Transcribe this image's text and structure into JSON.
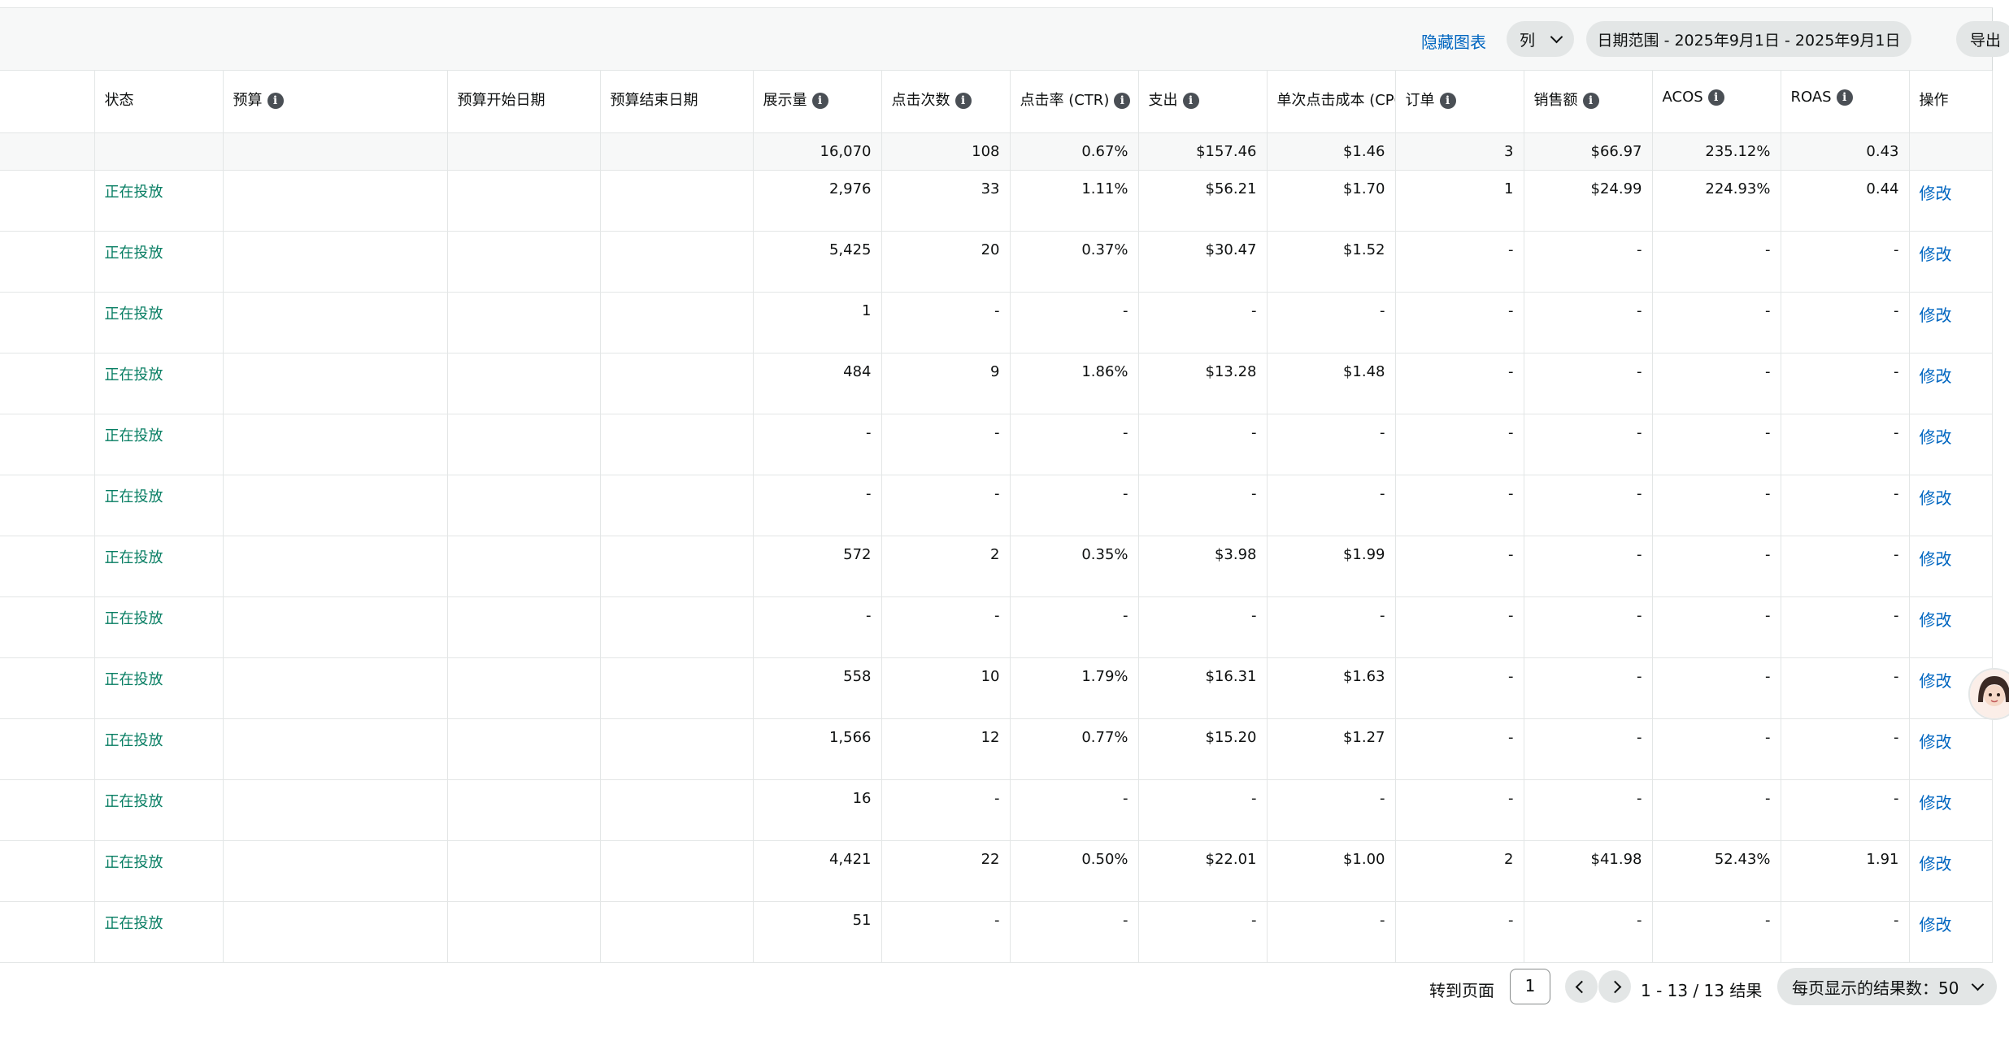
{
  "toolbar": {
    "hide_chart": "隐藏图表",
    "columns": "列",
    "date_range": "日期范围 - 2025年9月1日 - 2025年9月1日",
    "export": "导出"
  },
  "columns": [
    "状态",
    "预算",
    "预算开始日期",
    "预算结束日期",
    "展示量",
    "点击次数",
    "点击率 (CTR)",
    "支出",
    "单次点击成本 (CPC)",
    "订单",
    "销售额",
    "ACOS",
    "ROAS",
    "操作"
  ],
  "summary": [
    "",
    "",
    "",
    "",
    "16,070",
    "108",
    "0.67%",
    "$157.46",
    "$1.46",
    "3",
    "$66.97",
    "235.12%",
    "0.43",
    ""
  ],
  "rows": [
    [
      "正在投放",
      "",
      "",
      "",
      "2,976",
      "33",
      "1.11%",
      "$56.21",
      "$1.70",
      "1",
      "$24.99",
      "224.93%",
      "0.44",
      "修改"
    ],
    [
      "正在投放",
      "",
      "",
      "",
      "5,425",
      "20",
      "0.37%",
      "$30.47",
      "$1.52",
      "-",
      "-",
      "-",
      "-",
      "修改"
    ],
    [
      "正在投放",
      "",
      "",
      "",
      "1",
      "-",
      "-",
      "-",
      "-",
      "-",
      "-",
      "-",
      "-",
      "修改"
    ],
    [
      "正在投放",
      "",
      "",
      "",
      "484",
      "9",
      "1.86%",
      "$13.28",
      "$1.48",
      "-",
      "-",
      "-",
      "-",
      "修改"
    ],
    [
      "正在投放",
      "",
      "",
      "",
      "-",
      "-",
      "-",
      "-",
      "-",
      "-",
      "-",
      "-",
      "-",
      "修改"
    ],
    [
      "正在投放",
      "",
      "",
      "",
      "-",
      "-",
      "-",
      "-",
      "-",
      "-",
      "-",
      "-",
      "-",
      "修改"
    ],
    [
      "正在投放",
      "",
      "",
      "",
      "572",
      "2",
      "0.35%",
      "$3.98",
      "$1.99",
      "-",
      "-",
      "-",
      "-",
      "修改"
    ],
    [
      "正在投放",
      "",
      "",
      "",
      "-",
      "-",
      "-",
      "-",
      "-",
      "-",
      "-",
      "-",
      "-",
      "修改"
    ],
    [
      "正在投放",
      "",
      "",
      "",
      "558",
      "10",
      "1.79%",
      "$16.31",
      "$1.63",
      "-",
      "-",
      "-",
      "-",
      "修改"
    ],
    [
      "正在投放",
      "",
      "",
      "",
      "1,566",
      "12",
      "0.77%",
      "$15.20",
      "$1.27",
      "-",
      "-",
      "-",
      "-",
      "修改"
    ],
    [
      "正在投放",
      "",
      "",
      "",
      "16",
      "-",
      "-",
      "-",
      "-",
      "-",
      "-",
      "-",
      "-",
      "修改"
    ],
    [
      "正在投放",
      "",
      "",
      "",
      "4,421",
      "22",
      "0.50%",
      "$22.01",
      "$1.00",
      "2",
      "$41.98",
      "52.43%",
      "1.91",
      "修改"
    ],
    [
      "正在投放",
      "",
      "",
      "",
      "51",
      "-",
      "-",
      "-",
      "-",
      "-",
      "-",
      "-",
      "-",
      "修改"
    ]
  ],
  "pagination": {
    "goto_label": "转到页面",
    "page": "1",
    "result": "1 - 13 / 13 结果",
    "per_page": "每页显示的结果数：50"
  },
  "colors": {
    "status_green": "#067d62",
    "link_blue": "#0066c0"
  }
}
